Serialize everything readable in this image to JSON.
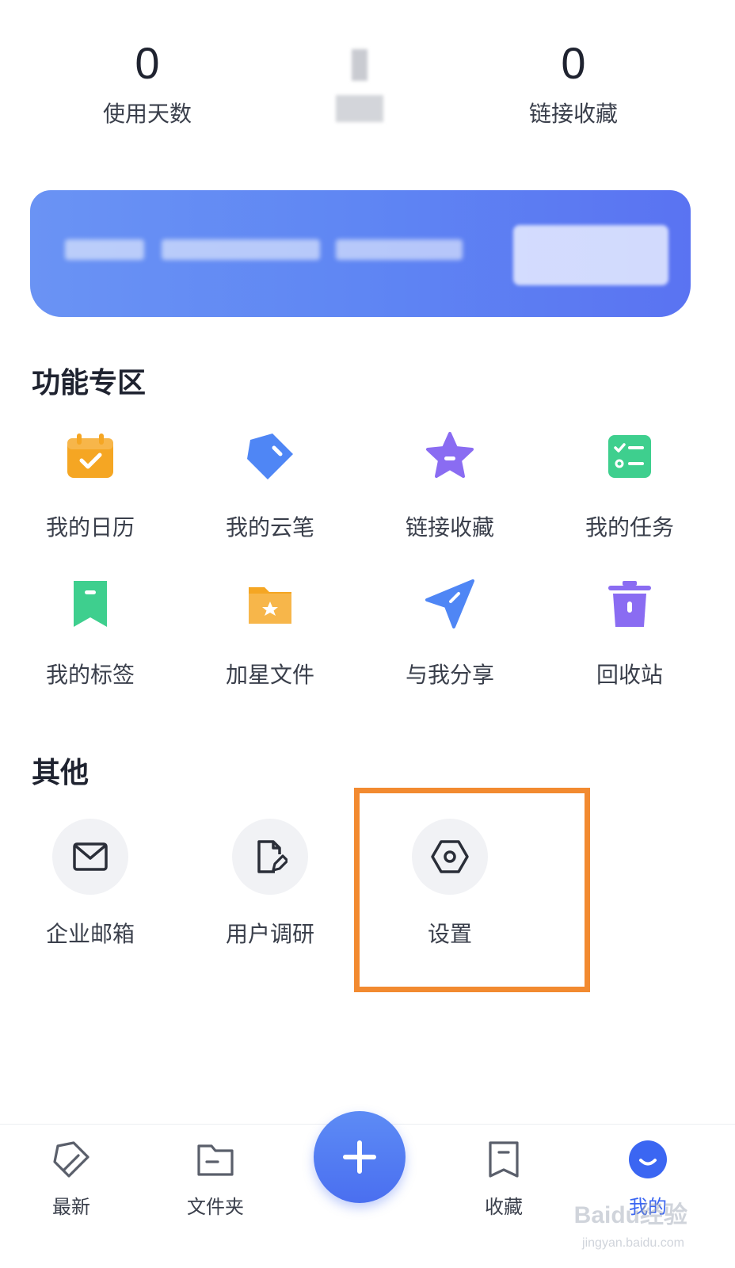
{
  "stats": {
    "days_value": "0",
    "days_label": "使用天数",
    "links_value": "0",
    "links_label": "链接收藏"
  },
  "sections": {
    "features_title": "功能专区",
    "other_title": "其他"
  },
  "features": [
    {
      "label": "我的日历",
      "icon": "calendar-icon",
      "color": "#f5a623"
    },
    {
      "label": "我的云笔",
      "icon": "tag-pen-icon",
      "color": "#4f86f5"
    },
    {
      "label": "链接收藏",
      "icon": "star-icon",
      "color": "#8a6cf2"
    },
    {
      "label": "我的任务",
      "icon": "checklist-icon",
      "color": "#3ecf8e"
    },
    {
      "label": "我的标签",
      "icon": "bookmark-icon",
      "color": "#3ecf8e"
    },
    {
      "label": "加星文件",
      "icon": "star-folder-icon",
      "color": "#f5a623"
    },
    {
      "label": "与我分享",
      "icon": "send-icon",
      "color": "#4f86f5"
    },
    {
      "label": "回收站",
      "icon": "trash-icon",
      "color": "#8a6cf2"
    }
  ],
  "other": [
    {
      "label": "企业邮箱",
      "icon": "mail-icon"
    },
    {
      "label": "用户调研",
      "icon": "survey-icon"
    },
    {
      "label": "设置",
      "icon": "settings-icon"
    }
  ],
  "nav": [
    {
      "label": "最新",
      "icon": "latest-icon"
    },
    {
      "label": "文件夹",
      "icon": "folder-icon"
    },
    {
      "label": "收藏",
      "icon": "bookmark-outline-icon"
    },
    {
      "label": "我的",
      "icon": "profile-icon"
    }
  ],
  "colors": {
    "accent": "#4a6ff0",
    "highlight": "#f28a30"
  },
  "watermark": {
    "text": "Baidu经验",
    "sub": "jingyan.baidu.com"
  }
}
